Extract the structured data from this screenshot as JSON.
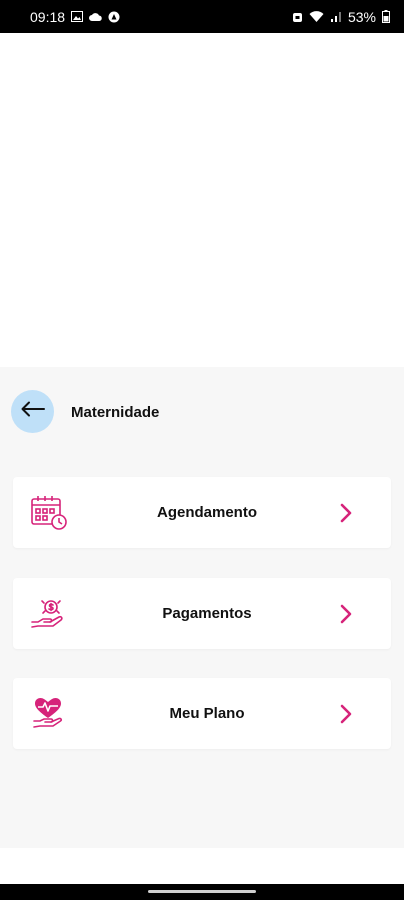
{
  "status_bar": {
    "time": "09:18",
    "battery": "53%",
    "icons_left": [
      "image-icon",
      "cloud-icon",
      "app-notification-icon"
    ],
    "icons_right": [
      "alarm-icon",
      "wifi-icon",
      "signal-icon",
      "battery-icon"
    ]
  },
  "header": {
    "back_icon": "arrow-left-icon",
    "title": "Maternidade"
  },
  "menu": {
    "items": [
      {
        "label": "Agendamento",
        "icon": "calendar-clock-icon"
      },
      {
        "label": "Pagamentos",
        "icon": "hand-money-icon"
      },
      {
        "label": "Meu Plano",
        "icon": "hand-heart-icon"
      }
    ]
  },
  "colors": {
    "accent": "#d6237a",
    "back_button_bg": "#bfe0f8",
    "sheet_bg": "#f7f7f7"
  }
}
